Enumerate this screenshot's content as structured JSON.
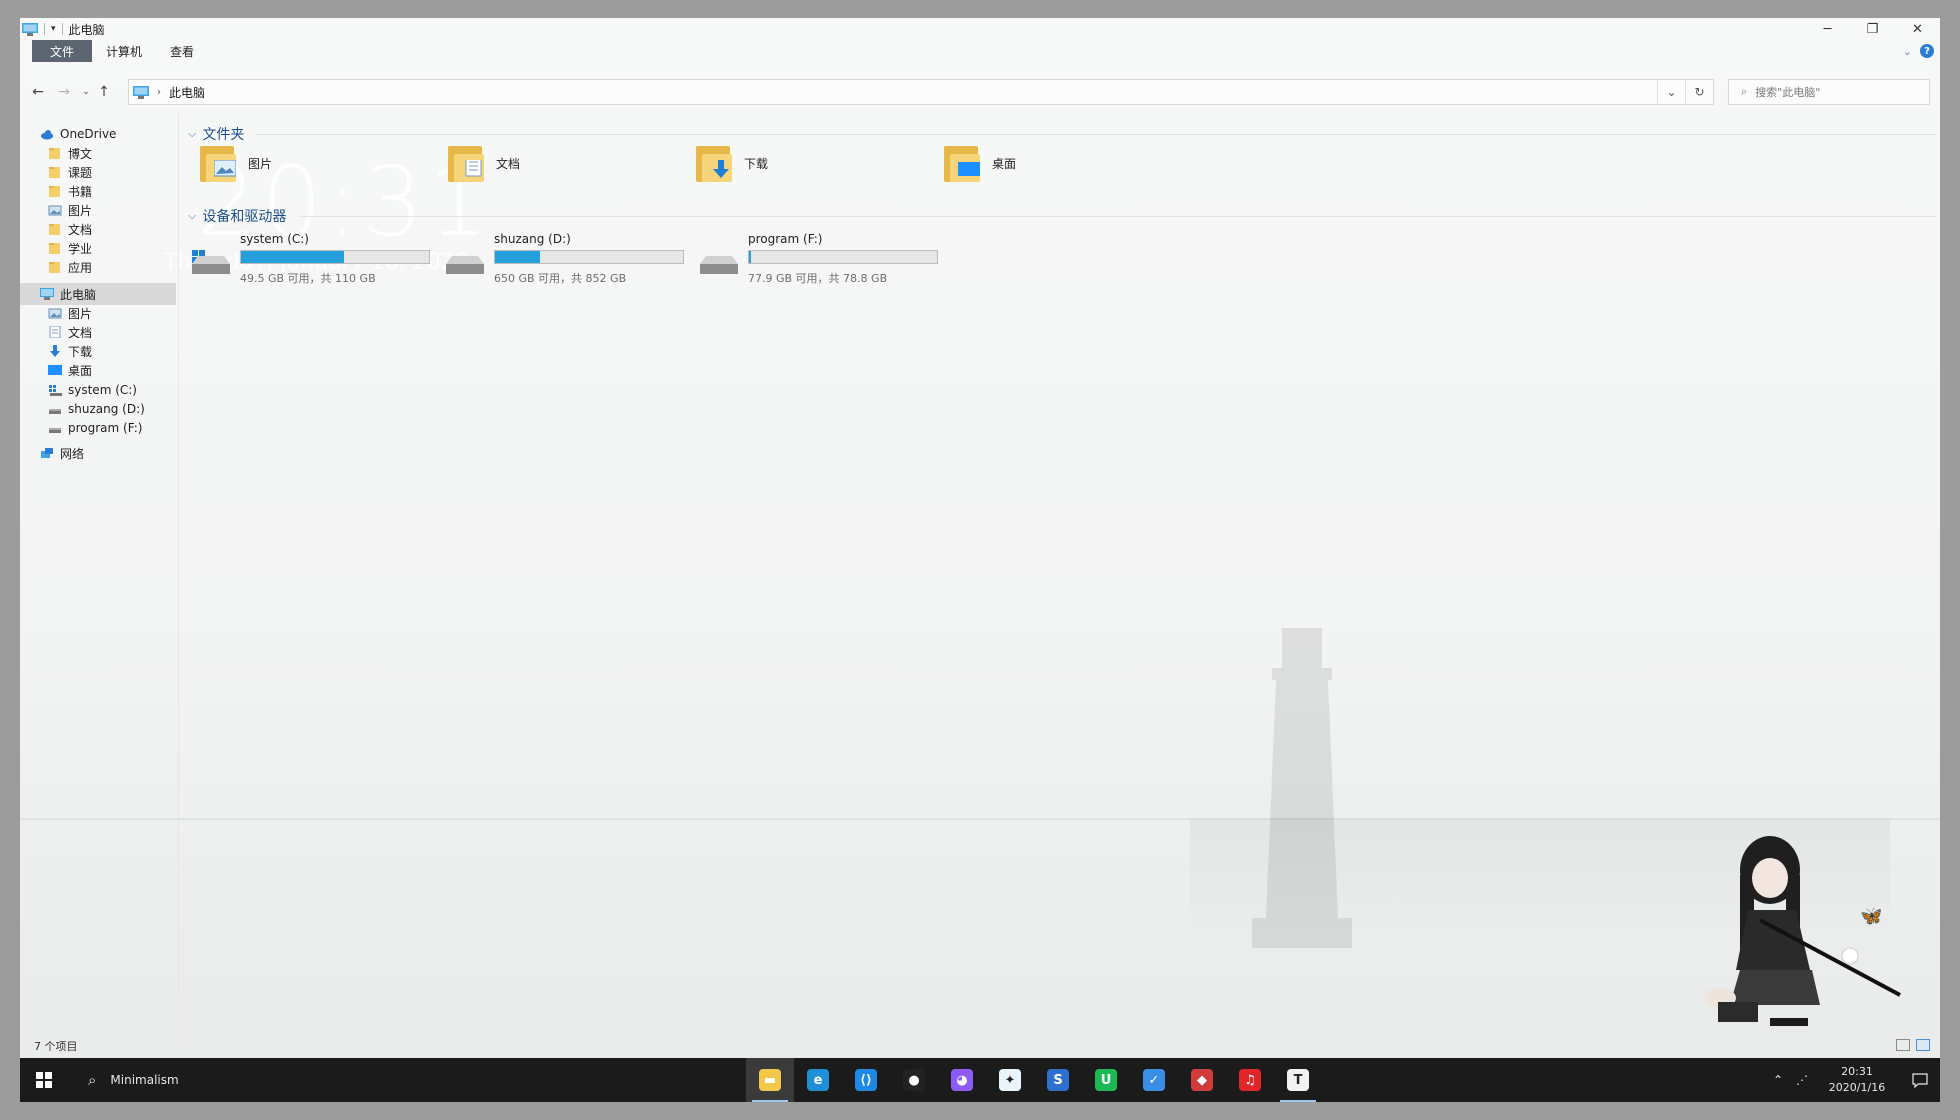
{
  "window": {
    "title": "此电脑",
    "ribbon_tabs": [
      "文件",
      "计算机",
      "查看"
    ]
  },
  "navigation": {
    "address_path": [
      "此电脑"
    ],
    "search_placeholder": "搜索\"此电脑\""
  },
  "sidebar": {
    "items": [
      {
        "label": "OneDrive",
        "icon": "cloud-icon",
        "level": 1
      },
      {
        "label": "博文",
        "icon": "folder-icon",
        "level": 2
      },
      {
        "label": "课题",
        "icon": "folder-icon",
        "level": 2
      },
      {
        "label": "书籍",
        "icon": "folder-icon",
        "level": 2
      },
      {
        "label": "图片",
        "icon": "pictures-icon",
        "level": 2
      },
      {
        "label": "文档",
        "icon": "folder-icon",
        "level": 2
      },
      {
        "label": "学业",
        "icon": "folder-icon",
        "level": 2
      },
      {
        "label": "应用",
        "icon": "folder-icon",
        "level": 2
      },
      {
        "label": "此电脑",
        "icon": "computer-icon",
        "level": 1,
        "selected": true
      },
      {
        "label": "图片",
        "icon": "pictures-icon",
        "level": 2
      },
      {
        "label": "文档",
        "icon": "documents-icon",
        "level": 2
      },
      {
        "label": "下载",
        "icon": "download-icon",
        "level": 2
      },
      {
        "label": "桌面",
        "icon": "desktop-icon",
        "level": 2
      },
      {
        "label": "system (C:)",
        "icon": "drive-system-icon",
        "level": 2
      },
      {
        "label": "shuzang (D:)",
        "icon": "drive-icon",
        "level": 2
      },
      {
        "label": "program (F:)",
        "icon": "drive-icon",
        "level": 2
      },
      {
        "label": "网络",
        "icon": "network-icon",
        "level": 1
      }
    ]
  },
  "content": {
    "folders_header": "文件夹",
    "folders": [
      {
        "label": "图片",
        "icon": "pictures-folder-icon"
      },
      {
        "label": "文档",
        "icon": "documents-folder-icon"
      },
      {
        "label": "下载",
        "icon": "downloads-folder-icon"
      },
      {
        "label": "桌面",
        "icon": "desktop-folder-icon"
      }
    ],
    "drives_header": "设备和驱动器",
    "drives": [
      {
        "name": "system (C:)",
        "info": "49.5 GB 可用，共 110 GB",
        "used_fraction": 0.55,
        "icon": "windows-drive-icon"
      },
      {
        "name": "shuzang (D:)",
        "info": "650 GB 可用，共 852 GB",
        "used_fraction": 0.24,
        "icon": "hard-drive-icon"
      },
      {
        "name": "program (F:)",
        "info": "77.9 GB 可用，共 78.8 GB",
        "used_fraction": 0.01,
        "icon": "hard-drive-icon"
      }
    ]
  },
  "wallpaper": {
    "clock_time": "20:31",
    "clock_date": "Thursday, January 16, 2020"
  },
  "status": {
    "item_count": "7 个项目"
  },
  "taskbar": {
    "search_text": "Minimalism",
    "apps": [
      {
        "name": "file-explorer-icon",
        "color": "#f3c84a",
        "active": true
      },
      {
        "name": "edge-icon",
        "color": "#1f8fd6"
      },
      {
        "name": "vscode-icon",
        "color": "#1e88e5"
      },
      {
        "name": "qq-icon",
        "color": "#222222"
      },
      {
        "name": "cat-app-icon",
        "color": "#8b5cf6"
      },
      {
        "name": "twitter-app-icon",
        "color": "#eaf4fb"
      },
      {
        "name": "s-app-icon",
        "color": "#2f6fd0"
      },
      {
        "name": "u-app-icon",
        "color": "#1db954"
      },
      {
        "name": "todo-icon",
        "color": "#3a8ee6"
      },
      {
        "name": "red-app-icon",
        "color": "#d23b3b"
      },
      {
        "name": "netease-music-icon",
        "color": "#e0262b"
      },
      {
        "name": "typora-icon",
        "color": "#f2f2f2",
        "running": true
      }
    ],
    "time": "20:31",
    "date": "2020/1/16"
  }
}
